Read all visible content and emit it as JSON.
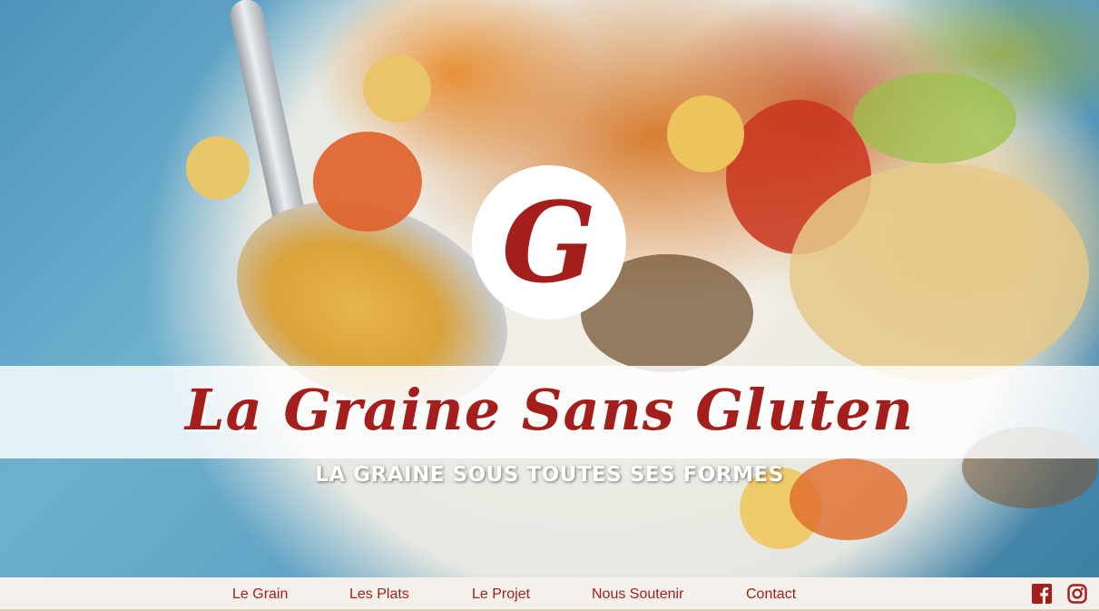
{
  "logo": {
    "letter": "G"
  },
  "hero": {
    "title": "La Graine Sans Gluten",
    "tagline": "LA GRAINE SOUS TOUTES SES FORMES"
  },
  "nav": {
    "items": [
      {
        "label": "Le Grain"
      },
      {
        "label": "Les Plats"
      },
      {
        "label": "Le Projet"
      },
      {
        "label": "Nous Soutenir"
      },
      {
        "label": "Contact"
      }
    ]
  },
  "social": {
    "icons": [
      "facebook-icon",
      "instagram-icon"
    ]
  },
  "colors": {
    "brand": "#a41f1b",
    "nav_background": "#f4f1ec",
    "band_background": "#ffffff"
  }
}
